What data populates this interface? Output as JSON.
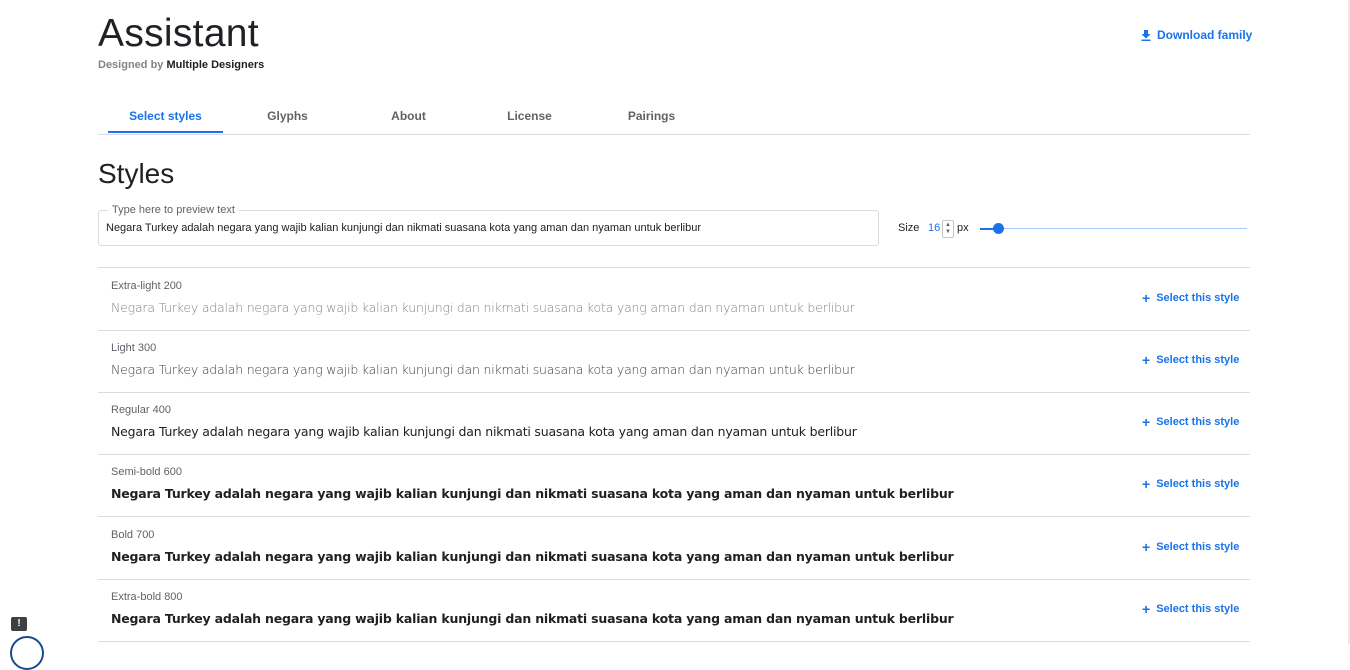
{
  "header": {
    "title": "Assistant",
    "designed_by_label": "Designed by",
    "designer": "Multiple Designers",
    "download_label": "Download family",
    "download_icon": "download-icon"
  },
  "tabs": [
    {
      "label": "Select styles",
      "active": true
    },
    {
      "label": "Glyphs",
      "active": false
    },
    {
      "label": "About",
      "active": false
    },
    {
      "label": "License",
      "active": false
    },
    {
      "label": "Pairings",
      "active": false
    }
  ],
  "styles_heading": "Styles",
  "preview": {
    "legend": "Type here to preview text",
    "value": "Negara Turkey adalah negara yang wajib kalian kunjungi dan nikmati suasana kota yang aman dan nyaman untuk berlibur"
  },
  "size": {
    "label": "Size",
    "value": "16",
    "unit": "px"
  },
  "styles": [
    {
      "name": "Extra-light 200",
      "sample": "Negara Turkey adalah negara yang wajib kalian kunjungi dan nikmati suasana kota yang aman dan nyaman untuk berlibur",
      "weight": 200,
      "button": "Select this style"
    },
    {
      "name": "Light 300",
      "sample": "Negara Turkey adalah negara yang wajib kalian kunjungi dan nikmati suasana kota yang aman dan nyaman untuk berlibur",
      "weight": 300,
      "button": "Select this style"
    },
    {
      "name": "Regular 400",
      "sample": "Negara Turkey adalah negara yang wajib kalian kunjungi dan nikmati suasana kota yang aman dan nyaman untuk berlibur",
      "weight": 400,
      "button": "Select this style"
    },
    {
      "name": "Semi-bold 600",
      "sample": "Negara Turkey adalah negara yang wajib kalian kunjungi dan nikmati suasana kota yang aman dan nyaman untuk berlibur",
      "weight": 600,
      "button": "Select this style"
    },
    {
      "name": "Bold 700",
      "sample": "Negara Turkey adalah negara yang wajib kalian kunjungi dan nikmati suasana kota yang aman dan nyaman untuk berlibur",
      "weight": 700,
      "button": "Select this style"
    },
    {
      "name": "Extra-bold 800",
      "sample": "Negara Turkey adalah negara yang wajib kalian kunjungi dan nikmati suasana kota yang aman dan nyaman untuk berlibur",
      "weight": 800,
      "button": "Select this style"
    }
  ],
  "colors": {
    "accent": "#1a73e8",
    "text": "#202124",
    "muted": "#5f6368",
    "divider": "#dadce0"
  },
  "feedback_icon": "feedback-icon"
}
